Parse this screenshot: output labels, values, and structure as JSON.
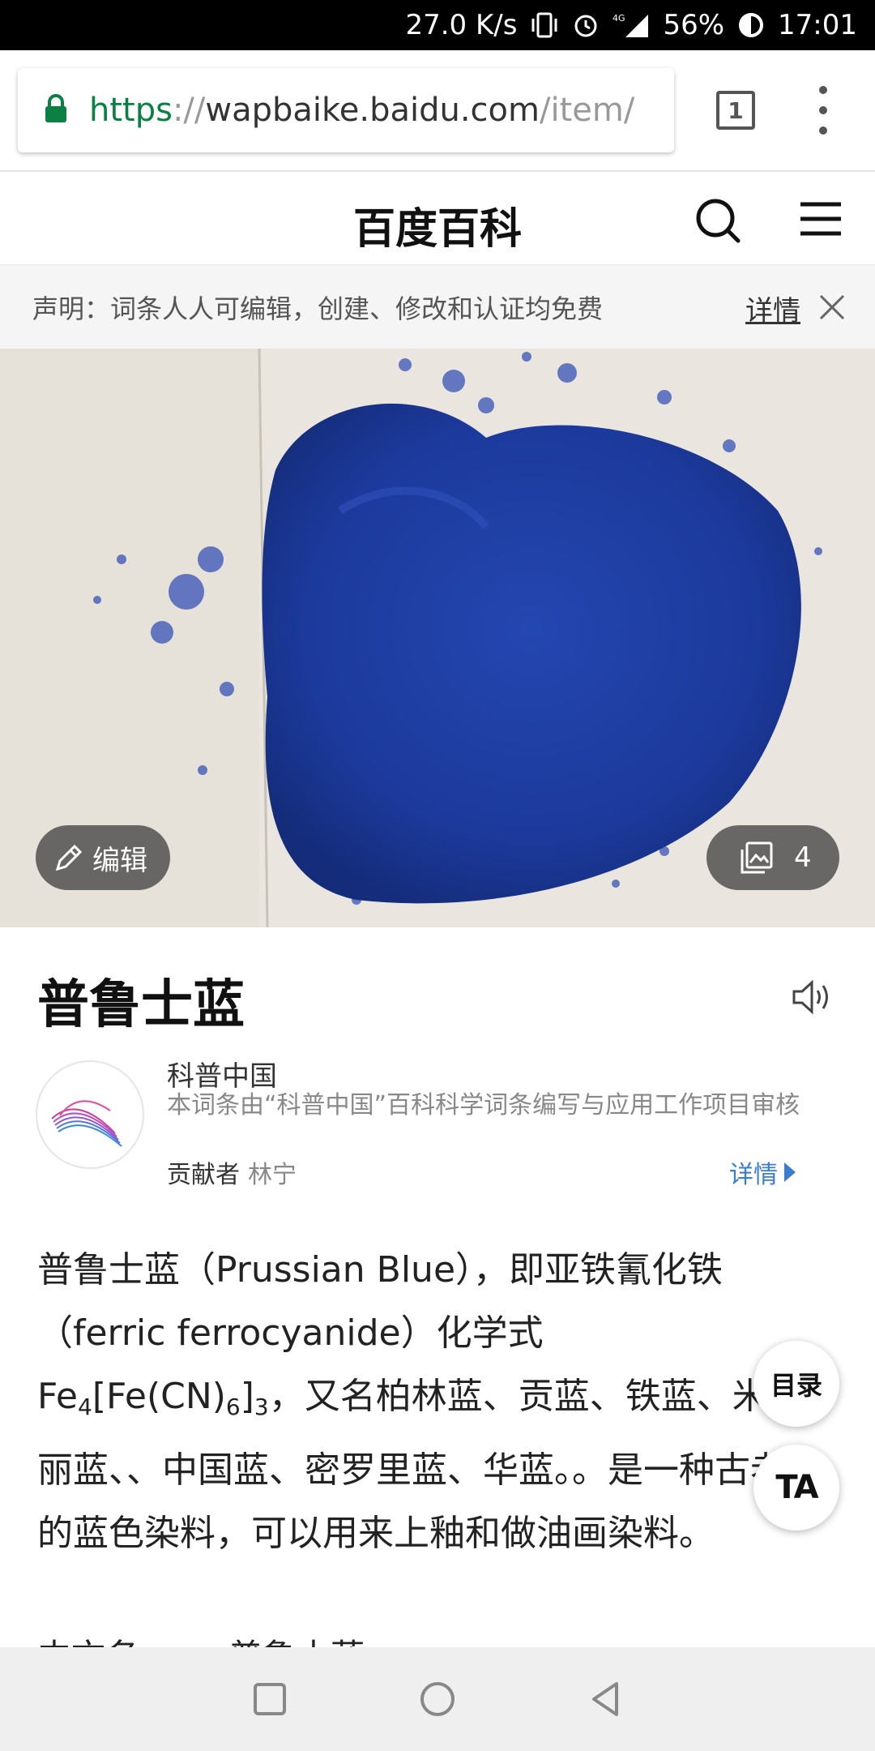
{
  "status_bar": {
    "net_speed": "27.0 K/s",
    "network": "4G",
    "battery": "56%",
    "time": "17:01"
  },
  "browser": {
    "url_scheme": "https",
    "url_sep": "://",
    "url_host": "wapbaike.baidu.com",
    "url_path": "/item/",
    "tab_count": "1"
  },
  "header": {
    "site_title": "百度百科"
  },
  "notice": {
    "text": "声明：词条人人可编辑，创建、修改和认证均免费",
    "detail_label": "详情"
  },
  "hero": {
    "edit_label": "编辑",
    "image_count": "4"
  },
  "entry": {
    "title": "普鲁士蓝"
  },
  "author": {
    "name": "科普中国",
    "description": "本词条由“科普中国”百科科学词条编写与应用工作项目审核",
    "contributor_label": "贡献者",
    "contributor_name": "林宁",
    "detail_label": "详情"
  },
  "summary": {
    "part1": "普鲁士蓝（Prussian Blue），即亚铁氰化铁（ferric ferrocyanide）化学式Fe",
    "sub1": "4",
    "part2": "[Fe(CN)",
    "sub2": "6",
    "part3": "]",
    "sub3": "3",
    "part4": "，又名柏林蓝、贡蓝、铁蓝、米洛丽蓝、、中国蓝、密罗里蓝、华蓝。。是一种古老的蓝色染料，可以用来上釉和做油画染料。"
  },
  "info_peek": {
    "label": "中文名",
    "value": "普鲁士蓝"
  },
  "floating": {
    "toc_label": "目录",
    "ta_label": "TA"
  },
  "icons": {
    "lock": "lock-icon",
    "search": "search-icon",
    "menu": "hamburger-menu-icon",
    "close": "close-icon",
    "edit": "pencil-icon",
    "gallery": "gallery-icon",
    "speaker": "speaker-icon"
  },
  "colors": {
    "url_secure": "#0b8043",
    "link_blue": "#3b7cd1",
    "powder_blue": "#1c3fa0"
  }
}
